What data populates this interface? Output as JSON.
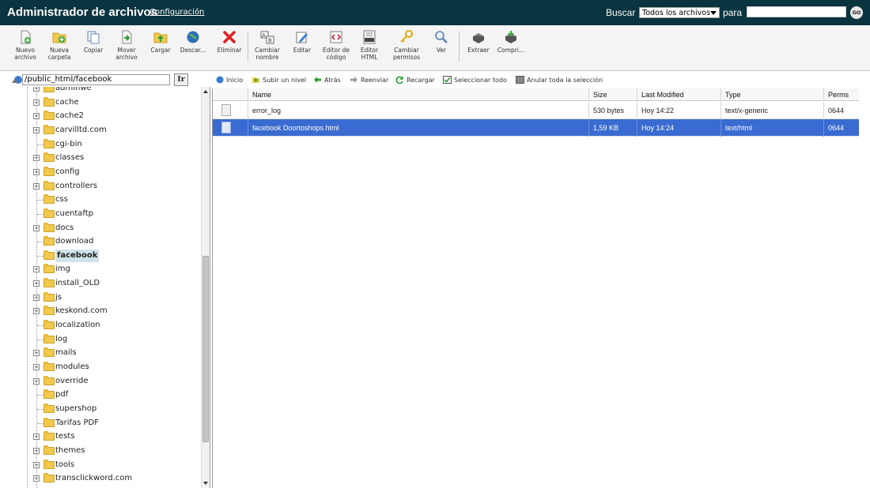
{
  "header": {
    "title": "Administrador de archivos",
    "config_link": "Configuración",
    "search_label": "Buscar",
    "search_scope": "Todos los archivos",
    "para_label": "para",
    "search_value": "",
    "go_label": "GO"
  },
  "toolbar": {
    "buttons": [
      {
        "l1": "Nuevo",
        "l2": "archivo",
        "icon": "new-file-icon"
      },
      {
        "l1": "Nueva",
        "l2": "carpeta",
        "icon": "new-folder-icon"
      },
      {
        "l1": "Copiar",
        "l2": "",
        "icon": "copy-icon"
      },
      {
        "l1": "Mover",
        "l2": "archivo",
        "icon": "move-icon"
      },
      {
        "l1": "Cargar",
        "l2": "",
        "icon": "upload-icon"
      },
      {
        "l1": "Descar...",
        "l2": "",
        "icon": "download-icon"
      },
      {
        "l1": "Eliminar",
        "l2": "",
        "icon": "delete-icon"
      },
      {
        "l1": "Cambiar",
        "l2": "nombre",
        "icon": "rename-icon"
      },
      {
        "l1": "Editar",
        "l2": "",
        "icon": "edit-icon"
      },
      {
        "l1": "Editor de",
        "l2": "código",
        "icon": "code-editor-icon"
      },
      {
        "l1": "Editor",
        "l2": "HTML",
        "icon": "html-editor-icon"
      },
      {
        "l1": "Cambiar",
        "l2": "permisos",
        "icon": "permissions-icon"
      },
      {
        "l1": "Ver",
        "l2": "",
        "icon": "view-icon"
      },
      {
        "l1": "Extraer",
        "l2": "",
        "icon": "extract-icon"
      },
      {
        "l1": "Compri...",
        "l2": "",
        "icon": "compress-icon"
      }
    ]
  },
  "path": {
    "value": "/public_html/facebook",
    "go_label": "Ir"
  },
  "tree": {
    "items": [
      {
        "label": "adminwe",
        "expandable": true
      },
      {
        "label": "cache",
        "expandable": true
      },
      {
        "label": "cache2",
        "expandable": true
      },
      {
        "label": "carvilltd.com",
        "expandable": true
      },
      {
        "label": "cgi-bin",
        "expandable": false
      },
      {
        "label": "classes",
        "expandable": true
      },
      {
        "label": "config",
        "expandable": true
      },
      {
        "label": "controllers",
        "expandable": true
      },
      {
        "label": "css",
        "expandable": false
      },
      {
        "label": "cuentaftp",
        "expandable": false
      },
      {
        "label": "docs",
        "expandable": true
      },
      {
        "label": "download",
        "expandable": false
      },
      {
        "label": "facebook",
        "expandable": false,
        "selected": true
      },
      {
        "label": "img",
        "expandable": true
      },
      {
        "label": "install_OLD",
        "expandable": true
      },
      {
        "label": "js",
        "expandable": true
      },
      {
        "label": "keskond.com",
        "expandable": true
      },
      {
        "label": "localization",
        "expandable": false
      },
      {
        "label": "log",
        "expandable": false
      },
      {
        "label": "mails",
        "expandable": true
      },
      {
        "label": "modules",
        "expandable": true
      },
      {
        "label": "override",
        "expandable": true
      },
      {
        "label": "pdf",
        "expandable": false
      },
      {
        "label": "supershop",
        "expandable": false
      },
      {
        "label": "Tarifas PDF",
        "expandable": false
      },
      {
        "label": "tests",
        "expandable": true
      },
      {
        "label": "themes",
        "expandable": true
      },
      {
        "label": "tools",
        "expandable": true
      },
      {
        "label": "transclickword.com",
        "expandable": true
      }
    ]
  },
  "actions": {
    "home": "Inicio",
    "up": "Subir un nivel",
    "back": "Atrás",
    "forward": "Reenviar",
    "reload": "Recargar",
    "select_all": "Seleccionar todo",
    "unselect_all": "Anular toda la selección"
  },
  "table": {
    "headers": {
      "name": "Name",
      "size": "Size",
      "modified": "Last Modified",
      "type": "Type",
      "perms": "Perms"
    },
    "rows": [
      {
        "name": "error_log",
        "size": "530 bytes",
        "modified": "Hoy 14:22",
        "type": "text/x-generic",
        "perms": "0644",
        "selected": false
      },
      {
        "name": "facebook Doortoshops.html",
        "size": "1,59 KB",
        "modified": "Hoy 14:24",
        "type": "text/html",
        "perms": "0644",
        "selected": true
      }
    ]
  },
  "colors": {
    "header_bg": "#0a3440",
    "selection": "#3a6bd1",
    "folder": "#f2c94c"
  }
}
